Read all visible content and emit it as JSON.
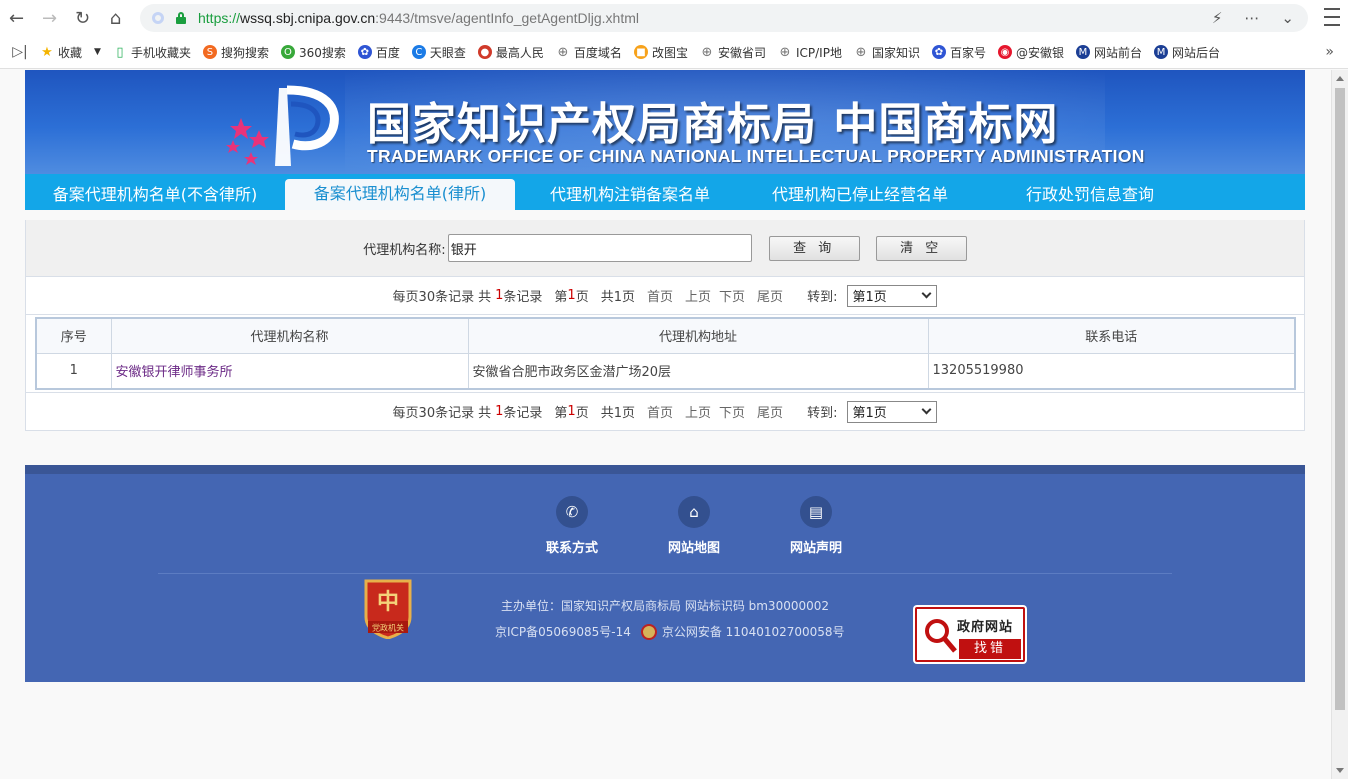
{
  "browser": {
    "url_scheme": "https://",
    "url_host": "wssq.sbj.cnipa.gov.cn",
    "url_rest": ":9443/tmsve/agentInfo_getAgentDljg.xhtml",
    "bookmarks": [
      {
        "label": "收藏",
        "icon": "star-icon",
        "color": "#f4b400"
      },
      {
        "label": "手机收藏夹",
        "icon": "phone-icon",
        "color": "#2db35d"
      },
      {
        "label": "搜狗搜索",
        "icon": "sogou-icon",
        "color": "#f26a21"
      },
      {
        "label": "360搜索",
        "icon": "360-icon",
        "color": "#38a83a"
      },
      {
        "label": "百度",
        "icon": "baidu-icon",
        "color": "#2f55d4"
      },
      {
        "label": "天眼查",
        "icon": "tianyancha-icon",
        "color": "#1b7be6"
      },
      {
        "label": "最高人民",
        "icon": "court-icon",
        "color": "#d03a2a"
      },
      {
        "label": "百度域名",
        "icon": "globe-icon",
        "color": "#777777"
      },
      {
        "label": "改图宝",
        "icon": "gaitubao-icon",
        "color": "#f7a21b"
      },
      {
        "label": "安徽省司",
        "icon": "globe-icon",
        "color": "#777777"
      },
      {
        "label": "ICP/IP地",
        "icon": "globe-icon",
        "color": "#777777"
      },
      {
        "label": "国家知识",
        "icon": "globe-icon",
        "color": "#777777"
      },
      {
        "label": "百家号",
        "icon": "baijiahao-icon",
        "color": "#2f55d4"
      },
      {
        "label": "@安徽银",
        "icon": "weibo-icon",
        "color": "#e6162d"
      },
      {
        "label": "网站前台",
        "icon": "site-icon",
        "color": "#1c3f95"
      },
      {
        "label": "网站后台",
        "icon": "site-icon",
        "color": "#1c3f95"
      }
    ]
  },
  "banner": {
    "title_cn": "国家知识产权局商标局 中国商标网",
    "title_en": "TRADEMARK OFFICE OF CHINA NATIONAL INTELLECTUAL PROPERTY ADMINISTRATION"
  },
  "tabs": [
    {
      "label": "备案代理机构名单(不含律所)",
      "active": false
    },
    {
      "label": "备案代理机构名单(律所)",
      "active": true
    },
    {
      "label": "代理机构注销备案名单",
      "active": false
    },
    {
      "label": "代理机构已停止经营名单",
      "active": false
    },
    {
      "label": "行政处罚信息查询",
      "active": false
    }
  ],
  "search": {
    "label": "代理机构名称:",
    "value": "银开",
    "query_btn": "查 询",
    "clear_btn": "清 空"
  },
  "pager": {
    "per_page": "每页30条记录",
    "total_pre": "共",
    "total_count": "1",
    "total_post": "条记录",
    "page_pre": "第",
    "current_page": "1",
    "page_post": "页",
    "total_pages": "共1页",
    "first": "首页",
    "prev": "上页",
    "next": "下页",
    "last": "尾页",
    "goto_label": "转到:",
    "goto_value": "第1页"
  },
  "table": {
    "headers": [
      "序号",
      "代理机构名称",
      "代理机构地址",
      "联系电话"
    ],
    "rows": [
      {
        "no": "1",
        "name": "安徽银开律师事务所",
        "address": "安徽省合肥市政务区金潜广场20层",
        "phone": "13205519980"
      }
    ]
  },
  "footer": {
    "links": [
      {
        "label": "联系方式",
        "icon": "phone-icon"
      },
      {
        "label": "网站地图",
        "icon": "map-icon"
      },
      {
        "label": "网站声明",
        "icon": "document-icon"
      }
    ],
    "info1": "主办单位：国家知识产权局商标局  网站标识码 bm30000002",
    "icp": "京ICP备05069085号-14",
    "police": "京公网安备 11040102700058号",
    "emblem_text": "党政机关",
    "gov_err_top": "政府网站",
    "gov_err_bottom": "找错"
  }
}
